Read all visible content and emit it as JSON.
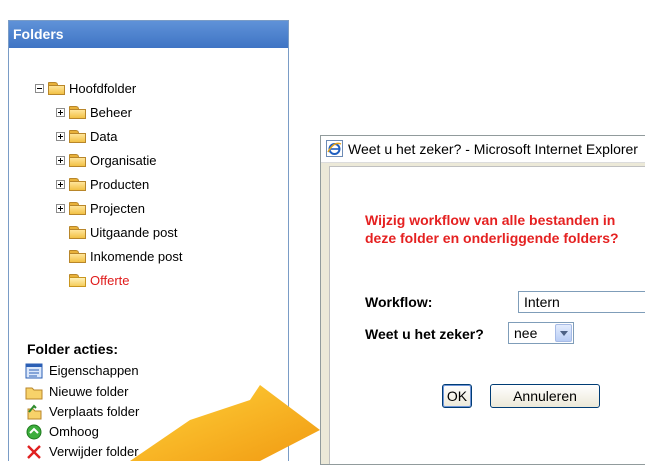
{
  "panel": {
    "title": "Folders",
    "tree": [
      {
        "label": "Hoofdfolder",
        "expander": "minus",
        "open": false,
        "red": false
      },
      {
        "label": "Beheer",
        "expander": "plus",
        "open": false,
        "red": false
      },
      {
        "label": "Data",
        "expander": "plus",
        "open": false,
        "red": false
      },
      {
        "label": "Organisatie",
        "expander": "plus",
        "open": false,
        "red": false
      },
      {
        "label": "Producten",
        "expander": "plus",
        "open": false,
        "red": false
      },
      {
        "label": "Projecten",
        "expander": "plus",
        "open": false,
        "red": false
      },
      {
        "label": "Uitgaande post",
        "expander": "none",
        "open": false,
        "red": false
      },
      {
        "label": "Inkomende post",
        "expander": "none",
        "open": false,
        "red": false
      },
      {
        "label": "Offerte",
        "expander": "none",
        "open": true,
        "red": true
      }
    ],
    "actions_title": "Folder acties:",
    "actions": [
      {
        "label": "Eigenschappen",
        "icon": "properties-icon"
      },
      {
        "label": "Nieuwe folder",
        "icon": "new-folder-icon"
      },
      {
        "label": "Verplaats folder",
        "icon": "move-folder-icon"
      },
      {
        "label": "Omhoog",
        "icon": "up-icon"
      },
      {
        "label": "Verwijder folder",
        "icon": "delete-icon"
      }
    ]
  },
  "dialog": {
    "title": "Weet u het zeker? - Microsoft Internet Explorer",
    "warning_line1": "Wijzig workflow van alle bestanden in",
    "warning_line2": "deze folder en onderliggende folders?",
    "workflow_label": "Workflow:",
    "workflow_value": "Intern",
    "confirm_label": "Weet u het zeker?",
    "confirm_value": "nee",
    "ok_label": "OK",
    "cancel_label": "Annuleren"
  },
  "colors": {
    "header_blue": "#3f74c4",
    "warning_red": "#e52121",
    "arrow_orange": "#f6a81c"
  }
}
